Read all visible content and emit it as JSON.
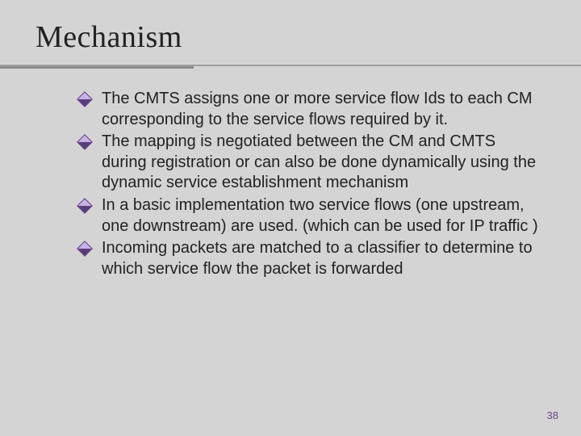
{
  "title": "Mechanism",
  "bullets": [
    "The CMTS assigns one or more service flow Ids to each CM corresponding to the service flows required by it.",
    "The mapping is negotiated between the CM and CMTS during registration or can also be done dynamically using the dynamic service establishment mechanism",
    "In a basic implementation two service flows (one upstream, one downstream) are used. (which can be used for IP traffic )",
    "Incoming packets are matched to a classifier to determine to which service flow the packet is forwarded"
  ],
  "page_number": "38"
}
